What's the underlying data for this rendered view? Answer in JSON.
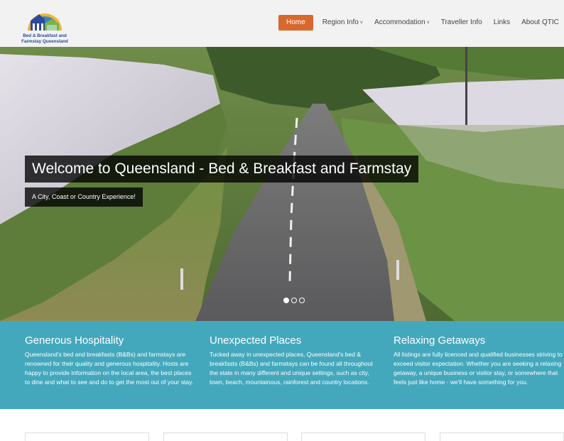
{
  "brand": {
    "logo_text": "Bed & Breakfast and Farmstay Queensland"
  },
  "nav": {
    "items": [
      {
        "label": "Home",
        "active": true,
        "dropdown": false
      },
      {
        "label": "Region Info",
        "active": false,
        "dropdown": true
      },
      {
        "label": "Accommodation",
        "active": false,
        "dropdown": true
      },
      {
        "label": "Traveller Info",
        "active": false,
        "dropdown": false
      },
      {
        "label": "Links",
        "active": false,
        "dropdown": false
      },
      {
        "label": "About QTIC",
        "active": false,
        "dropdown": false
      }
    ],
    "accent_color": "#d7692d"
  },
  "hero": {
    "title": "Welcome to Queensland - Bed & Breakfast and Farmstay",
    "subtitle": "A City, Coast or Country Experience!",
    "slides": 3,
    "active_slide": 1
  },
  "features": {
    "background_color": "#44a8bd",
    "items": [
      {
        "title": "Generous Hospitality",
        "text": "Queensland's bed and breakfasts (B&Bs) and farmstays are renowned for their quality and generous hospitality. Hosts are happy to provide information on the local area, the best places to dine and what to see and do to get the most out of your stay."
      },
      {
        "title": "Unexpected Places",
        "text": "Tucked away in unexpected places, Queensland's bed & breakfasts (B&Bs) and farmstays can be found all throughout the state in many different and unique settings, such as city, town, beach, mountainous, rainforest and country locations."
      },
      {
        "title": "Relaxing Getaways",
        "text": "All listings are fully licenced and qualified businesses striving to exceed visitor expectation. Whether you are seeking a relaxing getaway, a unique business or visitor stay, or somewhere that feels just like home - we'll have something for you."
      }
    ]
  }
}
